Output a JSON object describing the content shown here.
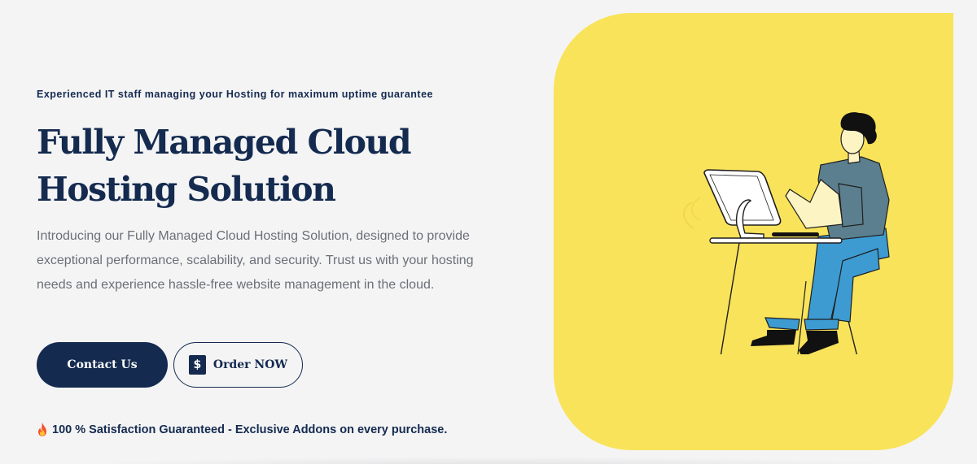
{
  "hero": {
    "eyebrow": "Experienced IT staff managing your Hosting for maximum uptime guarantee",
    "headline_line1": "Fully Managed Cloud",
    "headline_line2": "Hosting Solution",
    "intro": "Introducing our Fully Managed Cloud Hosting Solution, designed to provide exceptional performance, scalability, and security. Trust us with your hosting needs and experience hassle-free website management in the cloud.",
    "contact_label": "Contact Us",
    "order_label": "Order NOW",
    "order_icon": "dollar-icon",
    "guarantee_icon": "fire-icon",
    "guarantee": "100 % Satisfaction Guaranteed - Exclusive Addons on every purchase."
  },
  "colors": {
    "navy": "#142a4f",
    "yellow": "#f9e35b",
    "background": "#f4f4f5",
    "body_text": "#6b6f76",
    "shirt": "#5b7f8e",
    "pants": "#3d9bd2",
    "skin": "#fdf4c4"
  }
}
